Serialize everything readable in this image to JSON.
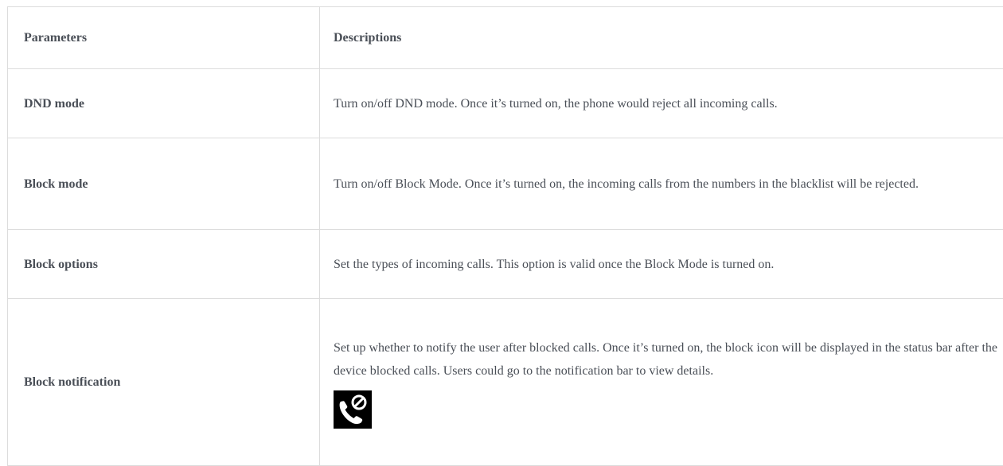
{
  "table": {
    "headers": [
      "Parameters",
      "Descriptions"
    ],
    "rows": [
      {
        "parameter": "DND mode",
        "description": "Turn on/off DND mode. Once it’s turned on, the phone would reject all incoming calls."
      },
      {
        "parameter": "Block mode",
        "description": "Turn on/off Block Mode. Once it’s turned on, the incoming calls from the numbers in the blacklist will be rejected."
      },
      {
        "parameter": "Block options",
        "description": "Set the types of incoming calls. This option is valid once the Block Mode is turned on."
      },
      {
        "parameter": "Block notification",
        "description": "Set up whether to notify the user after blocked calls. Once it’s turned on, the block icon will be displayed in the status bar after the device blocked calls. Users could go to the notification bar to view details.",
        "icon": "blocked-call-icon"
      }
    ]
  }
}
